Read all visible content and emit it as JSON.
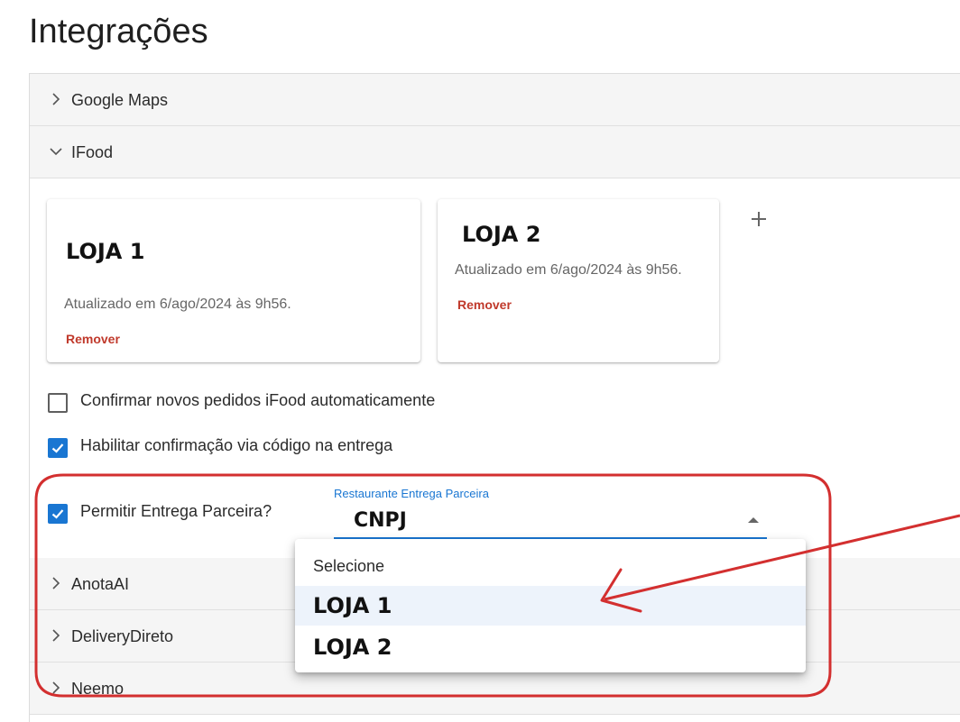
{
  "page": {
    "title": "Integrações"
  },
  "accordion": {
    "google_maps": {
      "label": "Google Maps",
      "expanded": false
    },
    "ifood": {
      "label": "IFood",
      "expanded": true,
      "stores": [
        {
          "name": "LOJA 1",
          "updated": "Atualizado em 6/ago/2024 às 9h56.",
          "remove_label": "Remover"
        },
        {
          "name": "LOJA 2",
          "updated": "Atualizado em 6/ago/2024 às 9h56.",
          "remove_label": "Remover"
        }
      ],
      "add_icon": "plus-icon",
      "options": [
        {
          "label": "Confirmar novos pedidos iFood automaticamente",
          "checked": false
        },
        {
          "label": "Habilitar confirmação via código na entrega",
          "checked": true
        },
        {
          "label": "Permitir Entrega Parceira?",
          "checked": true
        }
      ],
      "partner_select": {
        "label": "Restaurante Entrega Parceira",
        "value": "CNPJ",
        "open": true,
        "options": [
          "Selecione",
          "LOJA 1",
          "LOJA 2"
        ],
        "highlighted": "LOJA 1"
      }
    },
    "anotaai": {
      "label": "AnotaAI",
      "expanded": false
    },
    "deliverydireto": {
      "label": "DeliveryDireto",
      "expanded": false
    },
    "neemo": {
      "label": "Neemo",
      "expanded": false
    }
  },
  "colors": {
    "accent": "#1976d2",
    "remove": "#c0392b",
    "annotation": "#d32f2f",
    "header_bg": "#f5f5f5"
  }
}
